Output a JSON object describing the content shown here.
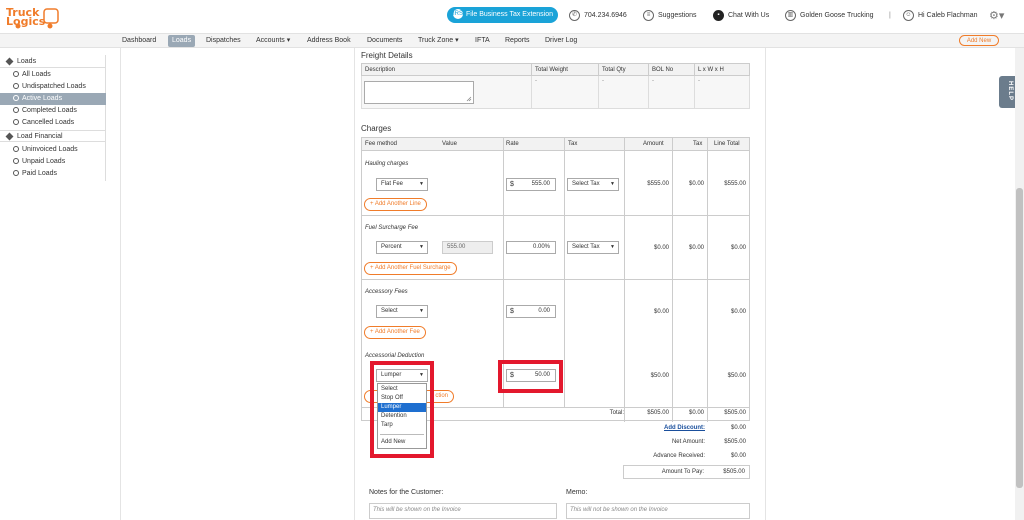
{
  "brand": {
    "logo_line1": "Truck",
    "logo_line2": "Logics"
  },
  "topbar": {
    "tax_button": "File Business Tax Extension",
    "tax_icon": "IRS",
    "phone": "704.234.6946",
    "suggestions": "Suggestions",
    "chat": "Chat With Us",
    "company": "Golden Goose Trucking",
    "separator": "|",
    "greeting": "Hi Caleb Flachman"
  },
  "nav": {
    "items": [
      "Dashboard",
      "Loads",
      "Dispatches",
      "Accounts ▾",
      "Address Book",
      "Documents",
      "Truck Zone ▾",
      "IFTA",
      "Reports",
      "Driver Log"
    ],
    "active": "Loads",
    "add_new": "Add New"
  },
  "sidebar": {
    "loads_group": "Loads",
    "loads_items": [
      "All Loads",
      "Undispatched Loads",
      "Active Loads",
      "Completed Loads",
      "Cancelled Loads"
    ],
    "financial_group": "Load Financial",
    "financial_items": [
      "Uninvoiced Loads",
      "Unpaid Loads",
      "Paid Loads"
    ]
  },
  "help_tab": "HELP",
  "freight": {
    "title": "Freight Details",
    "headers": [
      "Description",
      "Total Weight",
      "Total Qty",
      "BOL No",
      "L x W x H"
    ],
    "values": [
      "-",
      "-",
      "-",
      "-"
    ]
  },
  "charges": {
    "title": "Charges",
    "headers": [
      "Fee method",
      "Value",
      "Rate",
      "Tax",
      "Amount",
      "Tax",
      "Line Total"
    ],
    "hauling": {
      "label": "Hauling charges",
      "method": "Flat Fee",
      "currency": "$",
      "rate": "555.00",
      "tax": "Select Tax",
      "amount": "$555.00",
      "tax_amt": "$0.00",
      "line_total": "$555.00",
      "add_button": "+ Add Another Line"
    },
    "fuel": {
      "label": "Fuel Surcharge Fee",
      "method": "Percent",
      "value": "555.00",
      "rate": "0.00%",
      "tax": "Select Tax",
      "amount": "$0.00",
      "tax_amt": "$0.00",
      "line_total": "$0.00",
      "add_button": "+ Add Another Fuel Surcharge"
    },
    "accessory": {
      "label": "Accessory Fees",
      "method": "Select",
      "currency": "$",
      "rate": "0.00",
      "amount": "$0.00",
      "line_total": "$0.00",
      "add_button": "+ Add Another Fee"
    },
    "deduction": {
      "label": "Accessorial Deduction",
      "method": "Lumper",
      "currency": "$",
      "rate": "50.00",
      "amount": "$50.00",
      "line_total": "$50.00",
      "add_button_partial": "ction"
    },
    "dropdown_options": [
      "Select",
      "Stop Off",
      "Lumper",
      "Detention",
      "Tarp",
      "Add New"
    ],
    "dropdown_selected": "Lumper"
  },
  "totals": {
    "total_label": "Total:",
    "total_amount": "$505.00",
    "total_tax": "$0.00",
    "total_line": "$505.00",
    "discount_label": "Add Discount:",
    "discount": "$0.00",
    "net_label": "Net Amount:",
    "net": "$505.00",
    "advance_label": "Advance Received:",
    "advance": "$0.00",
    "pay_label": "Amount To Pay:",
    "pay": "$505.00"
  },
  "notes": {
    "customer_label": "Notes for the Customer:",
    "customer_placeholder": "This will be shown on the Invoice",
    "memo_label": "Memo:",
    "memo_placeholder": "This will not be shown on the Invoice"
  },
  "colors": {
    "accent": "#f07c2a",
    "highlight": "#e3182d",
    "nav_active": "#9aa8b5",
    "button_blue": "#1aa3d8"
  }
}
